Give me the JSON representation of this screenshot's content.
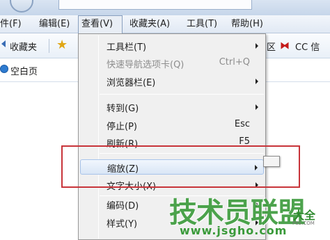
{
  "menubar": {
    "items": [
      {
        "label": "件(F)"
      },
      {
        "label": "编辑(E)"
      },
      {
        "label": "查看(V)"
      },
      {
        "label": "收藏夹(A)"
      },
      {
        "label": "工具(T)"
      },
      {
        "label": "帮助(H)"
      }
    ]
  },
  "favbar": {
    "favorites_label": "收藏夹",
    "right_text_1": "区",
    "right_text_2": "CC 信"
  },
  "tab": {
    "label": "空白页"
  },
  "view_menu": {
    "items": [
      {
        "label": "工具栏(T)",
        "shortcut": "",
        "submenu": true,
        "disabled": false
      },
      {
        "label": "快速导航选项卡(Q)",
        "shortcut": "Ctrl+Q",
        "submenu": false,
        "disabled": true
      },
      {
        "label": "浏览器栏(E)",
        "shortcut": "",
        "submenu": true,
        "disabled": false
      },
      {
        "label": "转到(G)",
        "shortcut": "",
        "submenu": true,
        "disabled": false
      },
      {
        "label": "停止(P)",
        "shortcut": "Esc",
        "submenu": false,
        "disabled": false
      },
      {
        "label": "刷新(R)",
        "shortcut": "F5",
        "submenu": false,
        "disabled": false
      },
      {
        "label": "缩放(Z)",
        "shortcut": "",
        "submenu": true,
        "disabled": false,
        "highlighted": true
      },
      {
        "label": "文字大小(X)",
        "shortcut": "",
        "submenu": true,
        "disabled": false
      },
      {
        "label": "编码(D)",
        "shortcut": "",
        "submenu": true,
        "disabled": false
      },
      {
        "label": "样式(Y)",
        "shortcut": "",
        "submenu": true,
        "disabled": false
      }
    ]
  },
  "watermark": {
    "title": "技术员联盟",
    "suffix": "大全",
    "url": "www.jsgho.com",
    "small": "P85.COM"
  },
  "colors": {
    "annotation_border": "#c8343a",
    "highlight_border": "#a8c4ea",
    "watermark_green": "#3a9a3a"
  },
  "icons": [
    "star-icon",
    "globe-icon",
    "chevron-right-icon",
    "cc-logo-icon"
  ]
}
